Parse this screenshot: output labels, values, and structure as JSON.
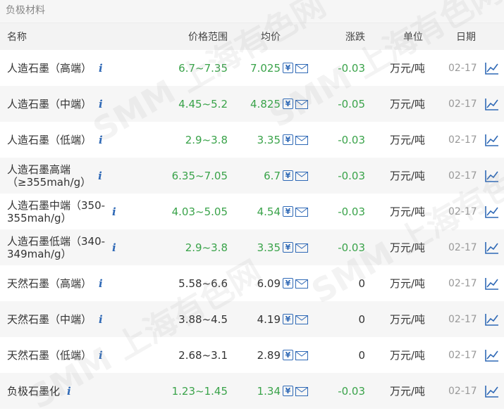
{
  "section_title": "负极材料",
  "headers": {
    "name": "名称",
    "range": "价格范围",
    "avg": "均价",
    "change": "涨跌",
    "unit": "单位",
    "date": "日期"
  },
  "watermark": "SMM 上海有色网",
  "colors": {
    "up_down_green": "#3aa34a",
    "info_blue": "#2f69b6",
    "zebra": "#f6f6f6"
  },
  "rows": [
    {
      "name_l1": "人造石墨（高端）",
      "name_l2": "",
      "range": "6.7~7.35",
      "avg": "7.025",
      "change": "-0.03",
      "unit": "万元/吨",
      "date": "02-17",
      "green": true
    },
    {
      "name_l1": "人造石墨（中端）",
      "name_l2": "",
      "range": "4.45~5.2",
      "avg": "4.825",
      "change": "-0.05",
      "unit": "万元/吨",
      "date": "02-17",
      "green": true
    },
    {
      "name_l1": "人造石墨（低端）",
      "name_l2": "",
      "range": "2.9~3.8",
      "avg": "3.35",
      "change": "-0.03",
      "unit": "万元/吨",
      "date": "02-17",
      "green": true
    },
    {
      "name_l1": "人造石墨高端",
      "name_l2": "（≥355mah/g）",
      "range": "6.35~7.05",
      "avg": "6.7",
      "change": "-0.03",
      "unit": "万元/吨",
      "date": "02-17",
      "green": true
    },
    {
      "name_l1": "人造石墨中端（350-",
      "name_l2": "355mah/g）",
      "range": "4.03~5.05",
      "avg": "4.54",
      "change": "-0.03",
      "unit": "万元/吨",
      "date": "02-17",
      "green": true
    },
    {
      "name_l1": "人造石墨低端（340-",
      "name_l2": "349mah/g）",
      "range": "2.9~3.8",
      "avg": "3.35",
      "change": "-0.03",
      "unit": "万元/吨",
      "date": "02-17",
      "green": true
    },
    {
      "name_l1": "天然石墨（高端）",
      "name_l2": "",
      "range": "5.58~6.6",
      "avg": "6.09",
      "change": "0",
      "unit": "万元/吨",
      "date": "02-17",
      "green": false
    },
    {
      "name_l1": "天然石墨（中端）",
      "name_l2": "",
      "range": "3.88~4.5",
      "avg": "4.19",
      "change": "0",
      "unit": "万元/吨",
      "date": "02-17",
      "green": false
    },
    {
      "name_l1": "天然石墨（低端）",
      "name_l2": "",
      "range": "2.68~3.1",
      "avg": "2.89",
      "change": "0",
      "unit": "万元/吨",
      "date": "02-17",
      "green": false
    },
    {
      "name_l1": "负极石墨化",
      "name_l2": "",
      "range": "1.23~1.45",
      "avg": "1.34",
      "change": "-0.03",
      "unit": "万元/吨",
      "date": "02-17",
      "green": true
    }
  ]
}
